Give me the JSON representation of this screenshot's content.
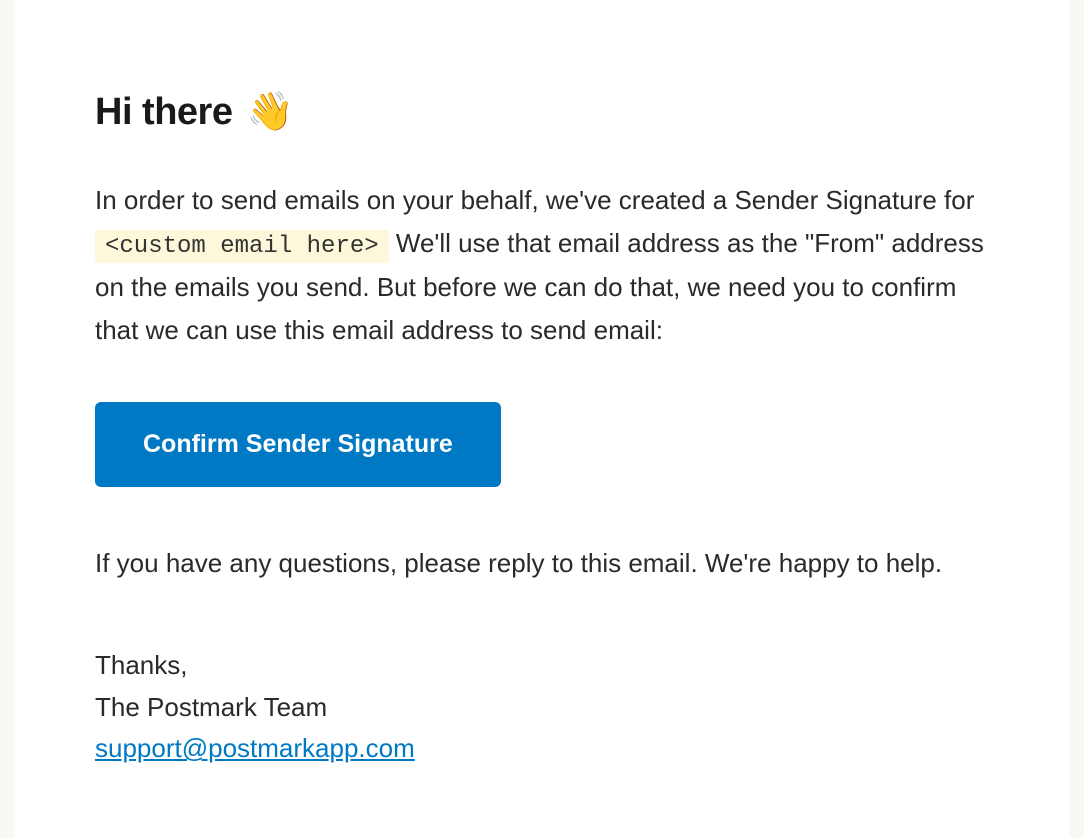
{
  "heading": {
    "text": "Hi there",
    "emoji": "👋"
  },
  "body": {
    "part1": "In order to send emails on your behalf, we've created a Sender Signature for",
    "placeholder": "<custom email here>",
    "part2": "We'll use that email address as the \"From\" address on the emails you send. But before we can do that, we need you to confirm that we can use this email address to send email:"
  },
  "cta": {
    "label": "Confirm Sender Signature"
  },
  "help": {
    "text": "If you have any questions, please reply to this email. We're happy to help."
  },
  "signature": {
    "thanks": "Thanks,",
    "team": "The Postmark Team",
    "email": "support@postmarkapp.com"
  }
}
